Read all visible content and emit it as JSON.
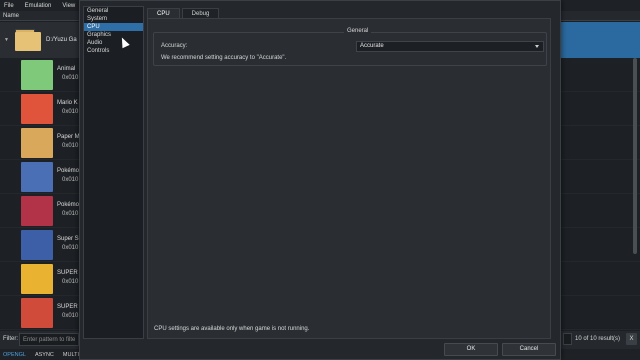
{
  "menubar": {
    "items": [
      "File",
      "Emulation",
      "View"
    ]
  },
  "list": {
    "column_name": "Name",
    "directory": "D:/Yuzu Ga",
    "games": [
      {
        "name": "Animal",
        "id": "0x010",
        "color": "#7fc97a"
      },
      {
        "name": "Mario K",
        "id": "0x010",
        "color": "#e0543c"
      },
      {
        "name": "Paper M",
        "id": "0x010",
        "color": "#d9a85a"
      },
      {
        "name": "Pokémo",
        "id": "0x010",
        "color": "#4a6fb5"
      },
      {
        "name": "Pokémo",
        "id": "0x010",
        "color": "#b23247"
      },
      {
        "name": "Super S",
        "id": "0x010",
        "color": "#3d5fa8"
      },
      {
        "name": "SUPER M",
        "id": "0x010",
        "color": "#e9b230"
      },
      {
        "name": "SUPER M",
        "id": "0x010",
        "color": "#d04b3a"
      }
    ]
  },
  "filter": {
    "label": "Filter:",
    "placeholder": "Enter pattern to filte",
    "results": "10 of 10 result(s)",
    "clear_label": "X"
  },
  "statusbar": {
    "items": [
      "OPENGL",
      "ASYNC",
      "MULTICOR"
    ]
  },
  "dialog": {
    "sidebar": [
      "General",
      "System",
      "CPU",
      "Graphics",
      "Audio",
      "Controls"
    ],
    "selected_sidebar": "CPU",
    "tabs": [
      "CPU",
      "Debug"
    ],
    "active_tab": "CPU",
    "group_title": "General",
    "accuracy_label": "Accuracy:",
    "accuracy_value": "Accurate",
    "accuracy_hint": "We recommend setting accuracy to \"Accurate\".",
    "footnote": "CPU settings are available only when game is not running.",
    "ok_label": "OK",
    "cancel_label": "Cancel"
  },
  "colors": {
    "accent": "#2d6fa6",
    "background": "#24282d"
  }
}
